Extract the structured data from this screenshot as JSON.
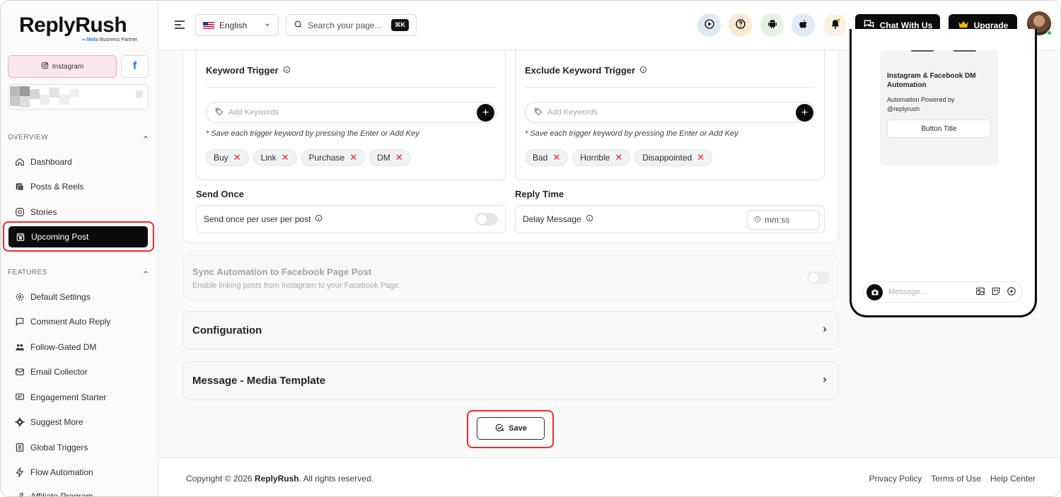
{
  "brand": {
    "name": "ReplyRush",
    "badge_meta": "∞ Meta",
    "badge_rest": " Business Partner"
  },
  "accounts": {
    "instagram_label": "Instagram",
    "facebook_label": "f"
  },
  "sidebar": {
    "overview_title": "OVERVIEW",
    "overview_items": [
      {
        "label": "Dashboard",
        "icon": "home-icon"
      },
      {
        "label": "Posts & Reels",
        "icon": "image-icon"
      },
      {
        "label": "Stories",
        "icon": "instagram-icon"
      },
      {
        "label": "Upcoming Post",
        "icon": "calendar-icon"
      }
    ],
    "features_title": "FEATURES",
    "feature_items": [
      {
        "label": "Default Settings",
        "icon": "gear-icon"
      },
      {
        "label": "Comment Auto Reply",
        "icon": "comment-icon"
      },
      {
        "label": "Follow-Gated DM",
        "icon": "users-icon"
      },
      {
        "label": "Email Collector",
        "icon": "mail-icon"
      },
      {
        "label": "Engagement Starter",
        "icon": "chat-icon"
      },
      {
        "label": "Suggest More",
        "icon": "cog-icon"
      },
      {
        "label": "Global Triggers",
        "icon": "list-icon"
      },
      {
        "label": "Flow Automation",
        "icon": "bolt-icon"
      },
      {
        "label": "Affiliate Program",
        "icon": "link-icon"
      }
    ]
  },
  "header": {
    "language": "English",
    "search_placeholder": "Search your page...",
    "search_shortcut": "⌘K",
    "chat_label": "Chat With Us",
    "upgrade_label": "Upgrade"
  },
  "triggers": {
    "keyword_title": "Keyword Trigger",
    "exclude_title": "Exclude Keyword Trigger",
    "add_placeholder": "Add Keywords",
    "hint": "* Save each trigger keyword by pressing the Enter or Add Key",
    "keywords": [
      "Buy",
      "Link",
      "Purchase",
      "DM"
    ],
    "exclude_keywords": [
      "Bad",
      "Horrible",
      "Disappointed"
    ]
  },
  "send_once": {
    "title": "Send Once",
    "label": "Send once per user per post"
  },
  "reply_time": {
    "title": "Reply Time",
    "label": "Delay Message",
    "placeholder": "mm:ss"
  },
  "sync": {
    "title": "Sync Automation to Facebook Page Post",
    "desc": "Enable linking posts from Instagram to your Facebook Page."
  },
  "accordions": {
    "configuration": "Configuration",
    "media_template": "Message - Media Template"
  },
  "save_label": "Save",
  "preview": {
    "title": "Instagram & Facebook DM Automation",
    "sub_line1": "Automation Powered by",
    "sub_line2": "@replyrush",
    "button_title": "Button Title",
    "message_placeholder": "Message..."
  },
  "footer": {
    "copyright_prefix": "Copyright © 2026 ",
    "brand": "ReplyRush",
    "copyright_suffix": ". All rights reserved.",
    "links": [
      "Privacy Policy",
      "Terms of Use",
      "Help Center"
    ]
  },
  "colors": {
    "accent_red": "#ef2b2b",
    "dark": "#0b0b0b",
    "instagram_bg": "#fde7ef",
    "facebook_blue": "#1877f2"
  }
}
